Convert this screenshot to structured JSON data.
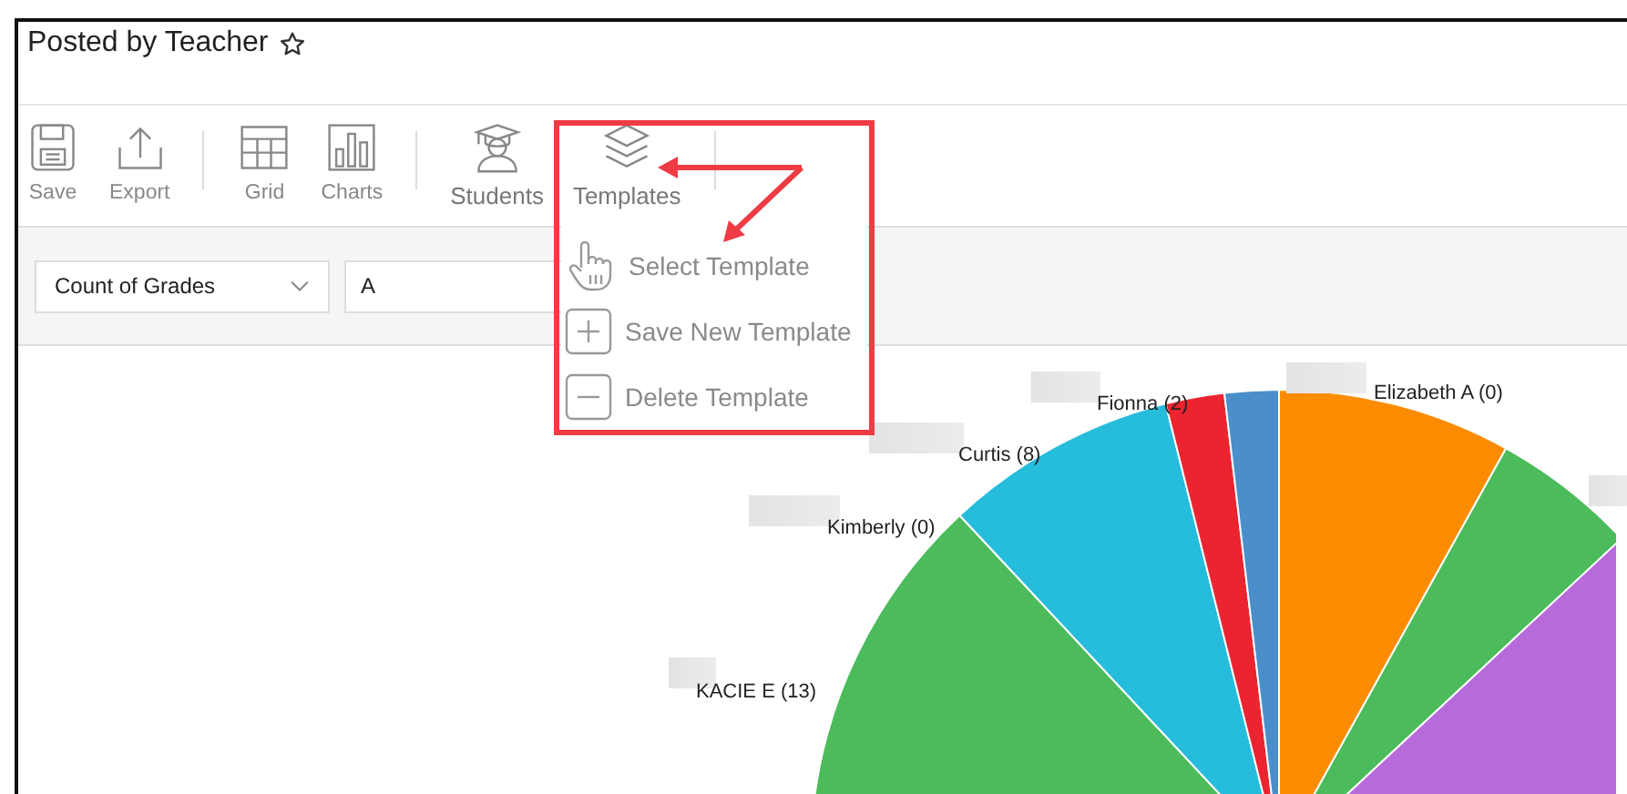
{
  "title": "Posted by Teacher",
  "toolbar": [
    [
      {
        "label": "Save",
        "kind": "save"
      },
      {
        "label": "Export",
        "kind": "export"
      }
    ],
    [
      {
        "label": "Grid",
        "kind": "grid"
      },
      {
        "label": "Charts",
        "kind": "charts"
      }
    ],
    [
      {
        "label": "Students",
        "kind": "students"
      },
      {
        "label": "Templates",
        "kind": "templates"
      }
    ]
  ],
  "filters": {
    "measure": "Count of Grades",
    "grade": "A"
  },
  "templates_menu": [
    {
      "label": "Select Template",
      "kind": "select"
    },
    {
      "label": "Save New Template",
      "kind": "add"
    },
    {
      "label": "Delete Template",
      "kind": "delete"
    }
  ],
  "chart_labels": [
    "Elizabeth A (0)",
    "Fionna (2)",
    "Curtis (8)",
    "Kimberly (0)",
    "KACIE E (13)"
  ]
}
